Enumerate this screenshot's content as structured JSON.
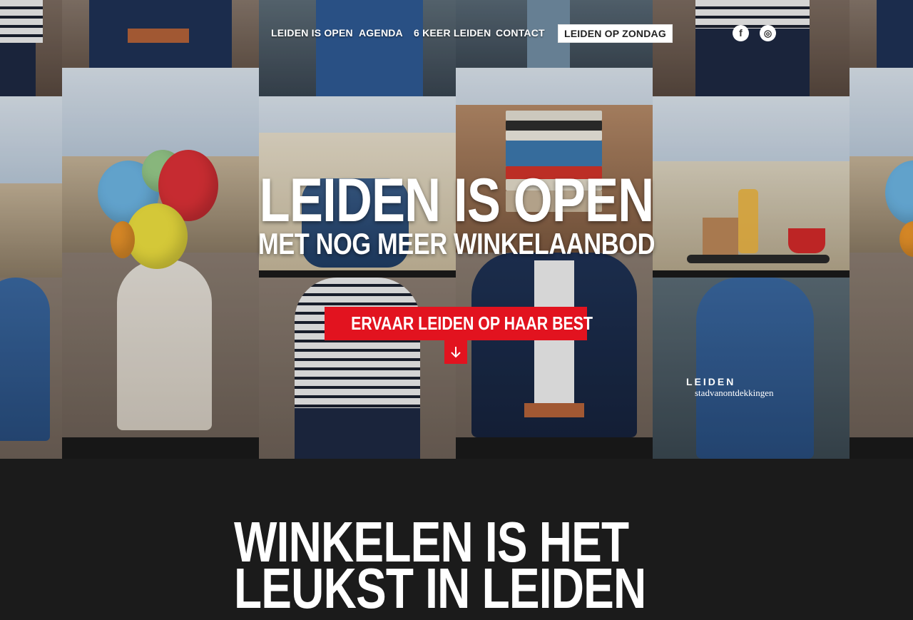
{
  "nav": {
    "items": [
      "LEIDEN IS OPEN",
      "AGENDA",
      "6 KEER LEIDEN",
      "CONTACT"
    ],
    "highlight": "LEIDEN OP ZONDAG"
  },
  "social": {
    "facebook": "f",
    "instagram": "◎"
  },
  "hero": {
    "title": "LEIDEN IS OPEN",
    "subtitle": "MET NOG MEER WINKELAANBOD",
    "cta": "ERVAAR LEIDEN OP HAAR BEST",
    "cta_icon": "arrow-down-icon"
  },
  "logo": {
    "line1": "LEIDEN",
    "line2": "stadvanontdekkingen"
  },
  "section": {
    "heading_line1": "WINKELEN IS HET",
    "heading_line2": "LEUKST IN LEIDEN"
  },
  "colors": {
    "accent": "#e2131f",
    "background": "#1b1b1b"
  }
}
